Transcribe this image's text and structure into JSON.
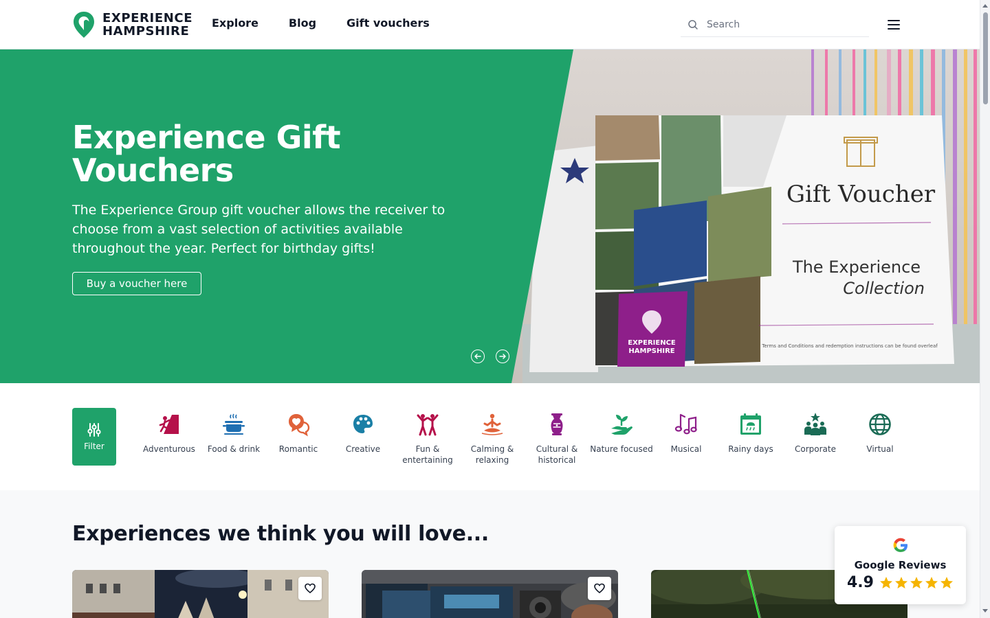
{
  "header": {
    "brand_line1": "EXPERIENCE",
    "brand_line2": "HAMPSHIRE",
    "nav": [
      {
        "label": "Explore"
      },
      {
        "label": "Blog"
      },
      {
        "label": "Gift vouchers"
      }
    ],
    "search_placeholder": "Search"
  },
  "hero": {
    "title": "Experience Gift Vouchers",
    "description": "The Experience Group gift voucher allows the receiver to choose from a vast selection of activities available throughout the year. Perfect for birthday gifts!",
    "cta_label": "Buy a voucher here",
    "voucher_card": {
      "heading": "Gift Voucher",
      "subheading_line1": "The Experience",
      "subheading_line2": "Collection",
      "brand_line1": "EXPERIENCE",
      "brand_line2": "HAMPSHIRE",
      "fine_print": "Terms and Conditions and redemption instructions can be found overleaf"
    }
  },
  "categories": {
    "filter_label": "Filter",
    "items": [
      {
        "label": "Adventurous",
        "icon": "climber-icon",
        "color": "#b5114a"
      },
      {
        "label": "Food & drink",
        "icon": "cooking-pot-icon",
        "color": "#1f6fb2"
      },
      {
        "label": "Romantic",
        "icon": "heart-chat-icon",
        "color": "#e0623a"
      },
      {
        "label": "Creative",
        "icon": "palette-icon",
        "color": "#1a7fa6"
      },
      {
        "label": "Fun & entertaining",
        "icon": "people-dancing-icon",
        "color": "#b5114a"
      },
      {
        "label": "Calming & relaxing",
        "icon": "meditation-icon",
        "color": "#e0623a"
      },
      {
        "label": "Cultural & historical",
        "icon": "vase-icon",
        "color": "#8e1f8a"
      },
      {
        "label": "Nature focused",
        "icon": "plant-hand-icon",
        "color": "#1fa26a"
      },
      {
        "label": "Musical",
        "icon": "music-notes-icon",
        "color": "#8e1f8a"
      },
      {
        "label": "Rainy days",
        "icon": "rain-calendar-icon",
        "color": "#1fa26a"
      },
      {
        "label": "Corporate",
        "icon": "team-icon",
        "color": "#1a6b55"
      },
      {
        "label": "Virtual",
        "icon": "globe-icon",
        "color": "#1a6b55"
      }
    ]
  },
  "section": {
    "title": "Experiences we think you will love..."
  },
  "reviews": {
    "title": "Google Reviews",
    "score": "4.9",
    "stars": 5
  },
  "colors": {
    "brand_green": "#1fa26a",
    "text_dark": "#111827",
    "star_yellow": "#f5b400"
  }
}
